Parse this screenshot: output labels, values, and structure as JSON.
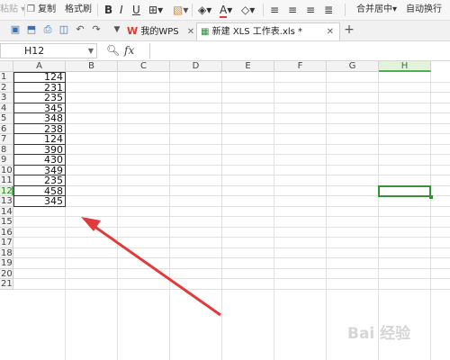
{
  "toolbar": {
    "paste_label": "粘贴",
    "copy_label": "复制",
    "format_painter_label": "格式刷",
    "bold_label": "B",
    "italic_label": "I",
    "underline_label": "U",
    "merge_center_label": "合并居中",
    "auto_wrap_label": "自动换行"
  },
  "tabs": [
    {
      "label": "我的WPS"
    },
    {
      "label": "新建 XLS 工作表.xls *"
    }
  ],
  "formula_bar": {
    "cell_reference": "H12",
    "fx_label": "fx"
  },
  "columns": [
    "A",
    "B",
    "C",
    "D",
    "E",
    "F",
    "G",
    "H"
  ],
  "selected_column": "H",
  "rows": [
    "1",
    "2",
    "3",
    "4",
    "5",
    "6",
    "7",
    "8",
    "9",
    "10",
    "11",
    "12",
    "13",
    "14",
    "15",
    "16",
    "17",
    "18",
    "19",
    "20",
    "21"
  ],
  "selected_row": "12",
  "column_a_values": [
    "124",
    "231",
    "235",
    "345",
    "348",
    "238",
    "124",
    "390",
    "430",
    "349",
    "235",
    "458",
    "345"
  ],
  "watermark": "Bai 经验",
  "colors": {
    "wps_red": "#d83b2e",
    "selection_green": "#3a8f3a",
    "arrow_red": "#e23a3a"
  }
}
